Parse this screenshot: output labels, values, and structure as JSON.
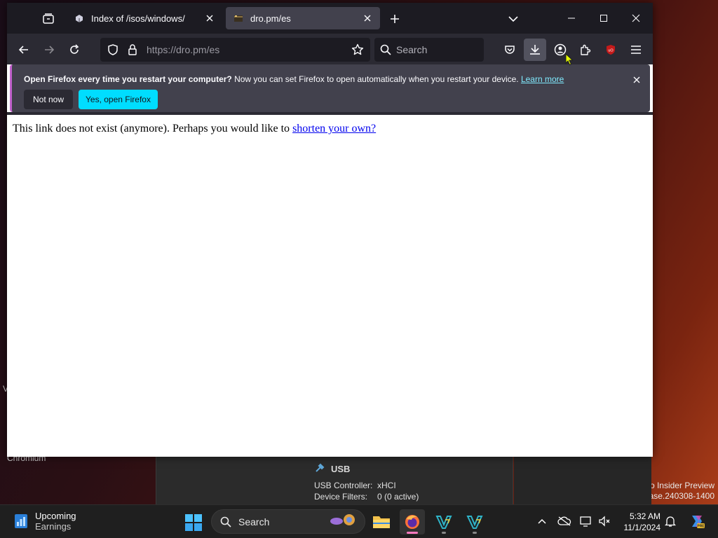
{
  "desktop": {
    "left_label": "Chromium",
    "left_fragment": "V",
    "right_line1": "o Insider Preview",
    "right_line2": "ease.240308-1400",
    "vbox": {
      "usb_title": "USB",
      "rows": [
        {
          "key": "USB Controller:",
          "value": "xHCI"
        },
        {
          "key": "Device Filters:",
          "value": "0 (0 active)"
        }
      ]
    }
  },
  "browser": {
    "tabs": [
      {
        "title": "Index of /isos/windows/",
        "active": false
      },
      {
        "title": "dro.pm/es",
        "active": true
      }
    ],
    "url": "https://dro.pm/es",
    "search_placeholder": "Search",
    "notification": {
      "bold": "Open Firefox every time you restart your computer?",
      "text": " Now you can set Firefox to open automatically when you restart your device. ",
      "link": "Learn more",
      "btn_not_now": "Not now",
      "btn_yes": "Yes, open Firefox"
    },
    "page": {
      "text": "This link does not exist (anymore). Perhaps you would like to ",
      "link": "shorten your own?"
    }
  },
  "taskbar": {
    "widget_title": "Upcoming",
    "widget_sub": "Earnings",
    "search_label": "Search",
    "time": "5:32 AM",
    "date": "11/1/2024"
  },
  "colors": {
    "accent_cyan": "#00ddff",
    "link_blue": "#0000ee",
    "notif_link": "#80ebff",
    "firefox_active_indicator": "#ff7ac0"
  }
}
